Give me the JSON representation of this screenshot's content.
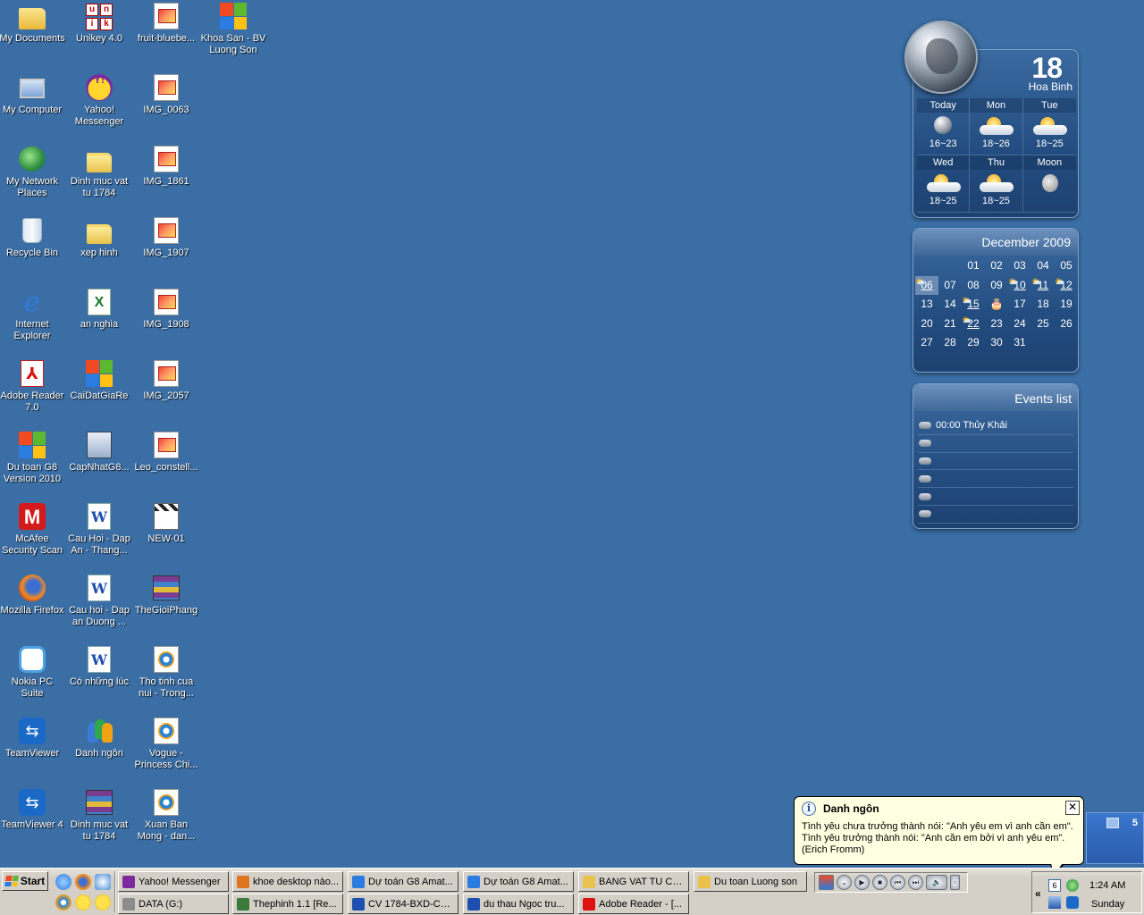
{
  "desktop_icons": [
    {
      "label": "My Documents",
      "icon": "folder-docs-icon"
    },
    {
      "label": "My Computer",
      "icon": "computer-icon"
    },
    {
      "label": "My Network Places",
      "icon": "network-icon"
    },
    {
      "label": "Recycle Bin",
      "icon": "recycle-bin-icon"
    },
    {
      "label": "Internet Explorer",
      "icon": "ie-icon"
    },
    {
      "label": "Adobe Reader 7.0",
      "icon": "pdf-icon"
    },
    {
      "label": "Du toan G8 Version 2010",
      "icon": "dt-icon"
    },
    {
      "label": "McAfee Security Scan",
      "icon": "mcafee-icon"
    },
    {
      "label": "Mozilla Firefox",
      "icon": "firefox-icon"
    },
    {
      "label": "Nokia PC Suite",
      "icon": "nokia-icon"
    },
    {
      "label": "TeamViewer",
      "icon": "teamviewer-icon"
    },
    {
      "label": "TeamViewer 4",
      "icon": "teamviewer-icon"
    },
    {
      "label": "Unikey 4.0",
      "icon": "unikey-icon"
    },
    {
      "label": "Yahoo! Messenger",
      "icon": "yahoo-icon"
    },
    {
      "label": "Dinh muc vat tu 1784",
      "icon": "folder-icon"
    },
    {
      "label": "xep hinh",
      "icon": "folder-icon"
    },
    {
      "label": "an nghia",
      "icon": "excel-icon"
    },
    {
      "label": "CaiDatGiaRe",
      "icon": "dt-icon"
    },
    {
      "label": "CapNhatG8...",
      "icon": "setup-icon"
    },
    {
      "label": "Cau Hoi - Dap An - Thang...",
      "icon": "word-icon"
    },
    {
      "label": "Cau hoi - Dap an Duong ...",
      "icon": "word-icon"
    },
    {
      "label": "Có những lúc",
      "icon": "word-icon"
    },
    {
      "label": "Danh ngôn",
      "icon": "people-icon"
    },
    {
      "label": "Dinh muc vat tu 1784",
      "icon": "rar-icon"
    },
    {
      "label": "fruit-bluebe...",
      "icon": "image-icon"
    },
    {
      "label": "IMG_0063",
      "icon": "image-icon"
    },
    {
      "label": "IMG_1861",
      "icon": "image-icon"
    },
    {
      "label": "IMG_1907",
      "icon": "image-icon"
    },
    {
      "label": "IMG_1908",
      "icon": "image-icon"
    },
    {
      "label": "IMG_2057",
      "icon": "image-icon"
    },
    {
      "label": "Leo_constell...",
      "icon": "image-icon"
    },
    {
      "label": "NEW-01",
      "icon": "clapper-icon"
    },
    {
      "label": "TheGioiPhang",
      "icon": "rar-icon"
    },
    {
      "label": "Tho tinh cua nui - Trong...",
      "icon": "media-icon"
    },
    {
      "label": "Vogue - Princess Chi...",
      "icon": "media-icon"
    },
    {
      "label": "Xuan Ban Mong - dan...",
      "icon": "media-icon"
    },
    {
      "label": "Khoa San - BV Luong Son",
      "icon": "dt-icon"
    }
  ],
  "weather": {
    "date": "18",
    "city": "Hoa Binh",
    "cells": [
      {
        "day": "Today",
        "temp": "16~23",
        "icon": "globe"
      },
      {
        "day": "Mon",
        "temp": "18~26",
        "icon": "sun-cloud"
      },
      {
        "day": "Tue",
        "temp": "18~25",
        "icon": "sun-cloud"
      },
      {
        "day": "Wed",
        "temp": "18~25",
        "icon": "sun-cloud"
      },
      {
        "day": "Thu",
        "temp": "18~25",
        "icon": "sun-cloud"
      },
      {
        "day": "Moon",
        "temp": "",
        "icon": "moon"
      }
    ]
  },
  "calendar": {
    "month": "December 2009",
    "days": [
      "",
      "",
      "01",
      "02",
      "03",
      "04",
      "05",
      "06",
      "07",
      "08",
      "09",
      "10",
      "11",
      "12",
      "13",
      "14",
      "15",
      "🎂",
      "17",
      "18",
      "19",
      "20",
      "21",
      "22",
      "23",
      "24",
      "25",
      "26",
      "27",
      "28",
      "29",
      "30",
      "31",
      "",
      ""
    ],
    "today": "06",
    "event_days": [
      "06",
      "10",
      "11",
      "12",
      "15",
      "22"
    ]
  },
  "events": {
    "title": "Events list",
    "items": [
      "00:00 Thủy Khải",
      "",
      "",
      "",
      "",
      ""
    ]
  },
  "balloon": {
    "title": "Danh ngôn",
    "line1": "Tình yêu chưa trưởng thành nói: \"Anh yêu em vì anh cần em\".",
    "line2": "Tình yêu trưởng thành nói: \"Anh cần em bởi vì anh yêu em\".",
    "line3": "(Erich Fromm)"
  },
  "desk_toolbar": {
    "count": "5"
  },
  "taskbar": {
    "start_label": "Start",
    "tasks": [
      {
        "label": "Yahoo! Messenger",
        "color": "#7b2b9e"
      },
      {
        "label": "khoe desktop nào...",
        "color": "#e0751d"
      },
      {
        "label": "Dự toán G8 Amat...",
        "color": "#2b7ce0"
      },
      {
        "label": "Dự toán G8 Amat...",
        "color": "#2b7ce0"
      },
      {
        "label": "BANG VAT TU CO...",
        "color": "#e8c24a"
      },
      {
        "label": "Du toan Luong son",
        "color": "#e8c24a"
      },
      {
        "label": "DATA (G:)",
        "color": "#8c8c8c"
      },
      {
        "label": "Thephinh 1.1  [Re...",
        "color": "#3a7a3a"
      },
      {
        "label": "CV 1784-BXD-Con...",
        "color": "#1e4fb0"
      },
      {
        "label": "du thau Ngoc tru...",
        "color": "#1e4fb0"
      },
      {
        "label": "Adobe Reader - [...",
        "color": "#d11"
      }
    ],
    "tray": {
      "time": "1:24 AM",
      "day": "Sunday",
      "calendar_badge": "6"
    }
  }
}
